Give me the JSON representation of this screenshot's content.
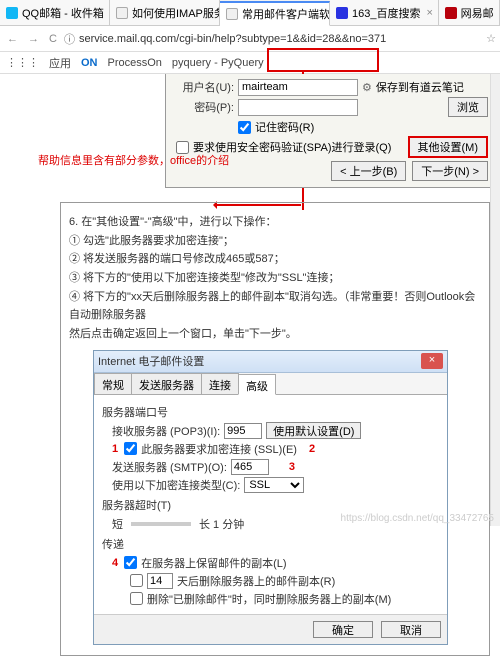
{
  "tabs": [
    {
      "label": "QQ邮箱 - 收件箱",
      "favcls": "fav-qq"
    },
    {
      "label": "如何使用IMAP服务？_",
      "favcls": "fav-g"
    },
    {
      "label": "常用邮件客户端软件设置",
      "favcls": "fav-g"
    },
    {
      "label": "163_百度搜索",
      "favcls": "fav-bd"
    },
    {
      "label": "网易邮",
      "favcls": "fav-163"
    }
  ],
  "addr": {
    "url": "service.mail.qq.com/cgi-bin/help?subtype=1&&id=28&&no=371"
  },
  "bookmarks": {
    "apps": "应用",
    "processon": "ProcessOn",
    "pyquery": "pyquery - PyQuery"
  },
  "form": {
    "user_label": "用户名(U):",
    "user_value": "mairteam",
    "cloud": "保存到有道云笔记",
    "pwd_label": "密码(P):",
    "remember": "记住密码(R)",
    "spa": "要求使用安全密码验证(SPA)进行登录(Q)",
    "other": "其他设置(M)",
    "prev": "< 上一步(B)",
    "next": "下一步(N) >",
    "browse": "浏览"
  },
  "redtext": "帮助信息里含有部分参数，office的介绍",
  "steps": {
    "header": "6. 在\"其他设置\"-\"高级\"中，进行以下操作：",
    "s1": "① 勾选\"此服务器要求加密连接\"；",
    "s2": "② 将发送服务器的端口号修改成465或587；",
    "s3": "③ 将下方的\"使用以下加密连接类型\"修改为\"SSL\"连接；",
    "s4": "④ 将下方的\"xx天后删除服务器上的邮件副本\"取消勾选。（非常重要！否则Outlook会自动删除服务器",
    "s5": "然后点击确定返回上一个窗口，单击\"下一步\"。"
  },
  "dialog": {
    "title": "Internet 电子邮件设置",
    "tabs": [
      "常规",
      "发送服务器",
      "连接",
      "高级"
    ],
    "sect_port": "服务器端口号",
    "pop_label": "接收服务器 (POP3)(I):",
    "pop_val": "995",
    "use_default": "使用默认设置(D)",
    "ssl_req": "此服务器要求加密连接 (SSL)(E)",
    "smtp_label": "发送服务器 (SMTP)(O):",
    "smtp_val": "465",
    "enc_label": "使用以下加密连接类型(C):",
    "enc_val": "SSL",
    "sect_timeout": "服务器超时(T)",
    "timeout_short": "短",
    "timeout_long": "长 1 分钟",
    "sect_delivery": "传递",
    "keep": "在服务器上保留邮件的副本(L)",
    "days_val": "14",
    "days_after": "天后删除服务器上的邮件副本(R)",
    "del_trash": "删除\"已删除邮件\"时，同时删除服务器上的副本(M)",
    "ok": "确定",
    "cancel": "取消"
  },
  "anno": {
    "n1": "1",
    "n2": "2",
    "n3": "3",
    "n4": "4"
  },
  "wm": "https://blog.csdn.net/qq_33472765"
}
